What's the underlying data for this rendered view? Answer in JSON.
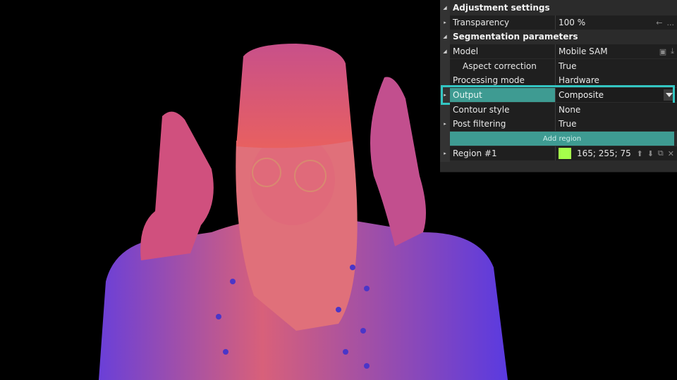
{
  "image": {
    "description": "Segmented cutout of a woman in a beanie and round glasses raising both hands, lit with pink/purple neon light, on black background"
  },
  "panel": {
    "groups": [
      {
        "title": "Adjustment settings",
        "expanded": true
      },
      {
        "title": "Segmentation parameters",
        "expanded": true
      }
    ],
    "rows": {
      "transparency": {
        "label": "Transparency",
        "value": "100 %"
      },
      "model": {
        "label": "Model",
        "value": "Mobile SAM"
      },
      "aspect_correction": {
        "label": "Aspect correction",
        "value": "True"
      },
      "processing_mode": {
        "label": "Processing mode",
        "value": "Hardware"
      },
      "output": {
        "label": "Output",
        "value": "Composite"
      },
      "contour_style": {
        "label": "Contour style",
        "value": "None"
      },
      "post_filtering": {
        "label": "Post filtering",
        "value": "True"
      }
    },
    "add_region_label": "Add region",
    "region": {
      "label": "Region #1",
      "color": "#a5ff4b",
      "rgb_text": "165; 255; 75"
    },
    "icons": {
      "expand": "▸",
      "collapse": "◢",
      "reset": "←",
      "more": "...",
      "folder": "▣",
      "download": "⤓",
      "up": "⬆",
      "down": "⬇",
      "copy": "⧉",
      "close": "✕"
    },
    "accent_color": "#33c6c3"
  }
}
